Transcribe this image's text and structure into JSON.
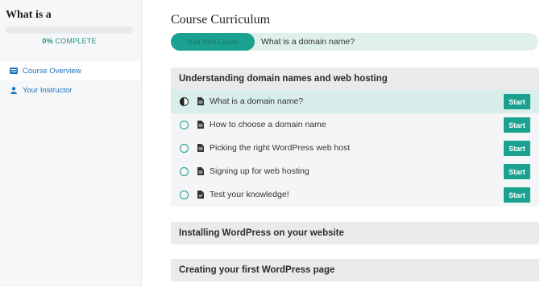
{
  "sidebar": {
    "title": "What is a",
    "progress_percent": "0%",
    "progress_label": "COMPLETE",
    "progress_value": 0,
    "items": [
      {
        "label": "Course Overview",
        "icon": "list-icon",
        "active": true
      },
      {
        "label": "Your Instructor",
        "icon": "user-icon",
        "active": false
      }
    ]
  },
  "main": {
    "title": "Course Curriculum",
    "next_button": "Start Next Lesson",
    "next_lesson": "What is a domain name?",
    "sections": [
      {
        "title": "Understanding domain names and web hosting",
        "lessons": [
          {
            "title": "What is a domain name?",
            "status": "in-progress",
            "type": "document",
            "action": "Start"
          },
          {
            "title": "How to choose a domain name",
            "status": "not-started",
            "type": "document",
            "action": "Start"
          },
          {
            "title": "Picking the right WordPress web host",
            "status": "not-started",
            "type": "document",
            "action": "Start"
          },
          {
            "title": "Signing up for web hosting",
            "status": "not-started",
            "type": "document",
            "action": "Start"
          },
          {
            "title": "Test your knowledge!",
            "status": "not-started",
            "type": "quiz",
            "action": "Start"
          }
        ]
      },
      {
        "title": "Installing WordPress on your website"
      },
      {
        "title": "Creating your first WordPress page"
      }
    ]
  },
  "colors": {
    "accent": "#1aa18f",
    "link": "#1e73be",
    "current_row": "#d8eeea"
  }
}
